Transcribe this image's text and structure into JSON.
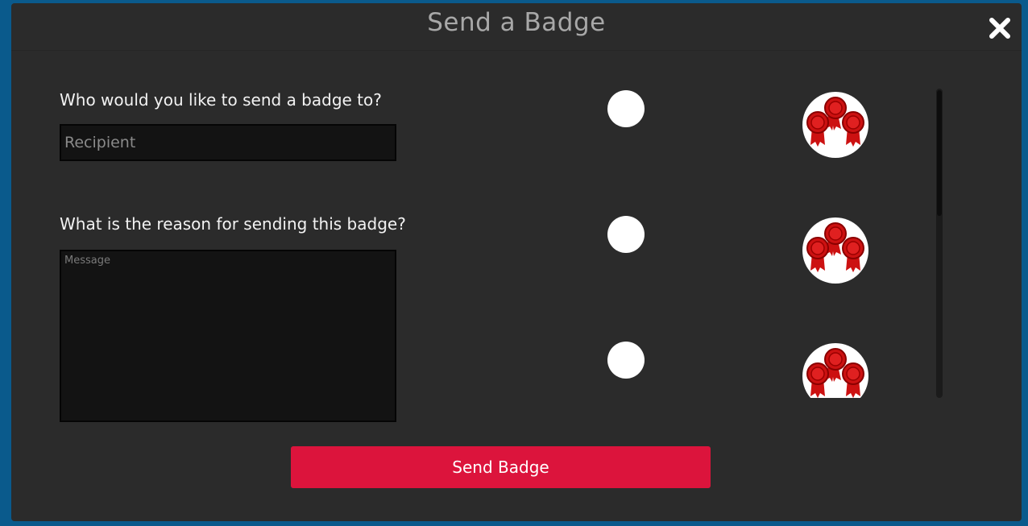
{
  "modal": {
    "title": "Send a Badge",
    "close_icon": "close-icon"
  },
  "form": {
    "recipient_label": "Who would you like to send a badge to?",
    "recipient_placeholder": "Recipient",
    "recipient_value": "",
    "reason_label": "What is the reason for sending this badge?",
    "message_placeholder": "Message",
    "message_value": ""
  },
  "badges": [
    {
      "icon": "award-ribbons-icon",
      "selected": false
    },
    {
      "icon": "award-ribbons-icon",
      "selected": false
    },
    {
      "icon": "award-ribbons-icon",
      "selected": false
    }
  ],
  "actions": {
    "send_label": "Send Badge"
  },
  "colors": {
    "background": "#0a5a8c",
    "panel": "#2b2b2b",
    "accent": "#dc143c",
    "badge_red": "#cc1111"
  }
}
